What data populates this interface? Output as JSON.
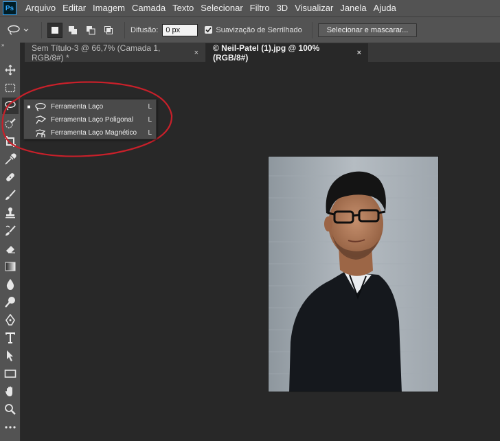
{
  "app": {
    "logo_text": "Ps"
  },
  "menu": [
    "Arquivo",
    "Editar",
    "Imagem",
    "Camada",
    "Texto",
    "Selecionar",
    "Filtro",
    "3D",
    "Visualizar",
    "Janela",
    "Ajuda"
  ],
  "options": {
    "feather_label": "Difusão:",
    "feather_value": "0 px",
    "antialias_label": "Suavização de Serrilhado",
    "antialias_checked": true,
    "select_mask_label": "Selecionar e mascarar..."
  },
  "tabs": [
    {
      "title": "Sem Título-3 @ 66,7% (Camada 1, RGB/8#) *",
      "close": "×",
      "active": false
    },
    {
      "title": "© Neil-Patel (1).jpg @ 100% (RGB/8#)",
      "close": "×",
      "active": true
    }
  ],
  "toolbar": {
    "collapse_glyph": "»"
  },
  "flyout": {
    "items": [
      {
        "label": "Ferramenta Laço",
        "shortcut": "L",
        "bullet": "■",
        "icon": "lasso-icon"
      },
      {
        "label": "Ferramenta Laço Poligonal",
        "shortcut": "L",
        "bullet": "",
        "icon": "polygonal-lasso-icon"
      },
      {
        "label": "Ferramenta Laço Magnético",
        "shortcut": "L",
        "bullet": "",
        "icon": "magnetic-lasso-icon"
      }
    ]
  },
  "tools": [
    "move-tool-icon",
    "marquee-tool-icon",
    "lasso-tool-icon",
    "quick-selection-icon",
    "crop-tool-icon",
    "eyedropper-icon",
    "healing-brush-icon",
    "brush-tool-icon",
    "clone-stamp-icon",
    "history-brush-icon",
    "eraser-icon",
    "gradient-icon",
    "blur-icon",
    "dodge-icon",
    "pen-tool-icon",
    "type-tool-icon",
    "path-selection-icon",
    "rectangle-tool-icon",
    "hand-tool-icon",
    "zoom-tool-icon",
    "more-tools-icon"
  ],
  "colors": {
    "annotation": "#c8202a",
    "accent": "#31a8ff"
  }
}
